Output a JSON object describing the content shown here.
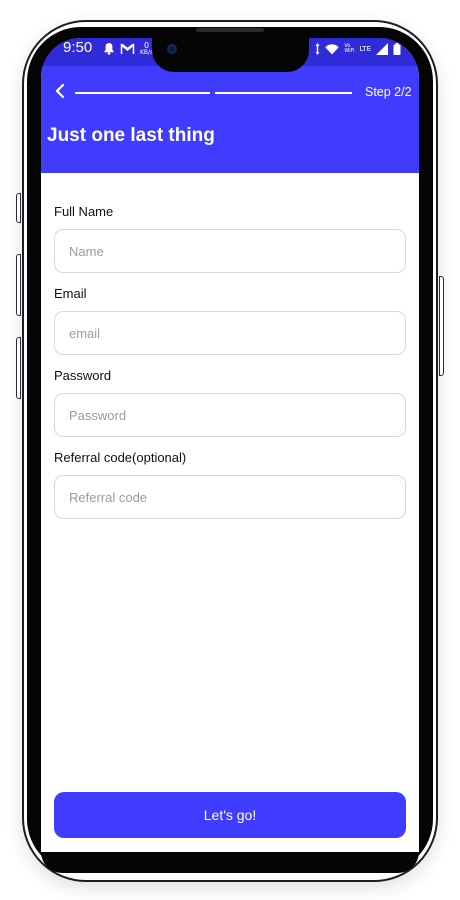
{
  "status_bar": {
    "time": "9:50",
    "speed_value": "0",
    "speed_unit": "KB/s",
    "wifi_label": "Vo\nWiFi",
    "lte_label": "LTE",
    "icons": [
      "notification-bell-icon",
      "gmail-icon",
      "data-speed-icon",
      "vibrate-icon",
      "wifi-icon",
      "signal-icon",
      "battery-icon"
    ]
  },
  "header": {
    "step": "Step 2/2",
    "title": "Just one last thing",
    "accent_color": "#3f3cff",
    "progress_segments": 2,
    "progress_completed": 2
  },
  "form": {
    "full_name": {
      "label": "Full Name",
      "placeholder": "Name"
    },
    "email": {
      "label": "Email",
      "placeholder": "email"
    },
    "password": {
      "label": "Password",
      "placeholder": "Password"
    },
    "referral": {
      "label": "Referral code(optional)",
      "placeholder": "Referral code"
    }
  },
  "submit": {
    "label": "Let's go!"
  }
}
